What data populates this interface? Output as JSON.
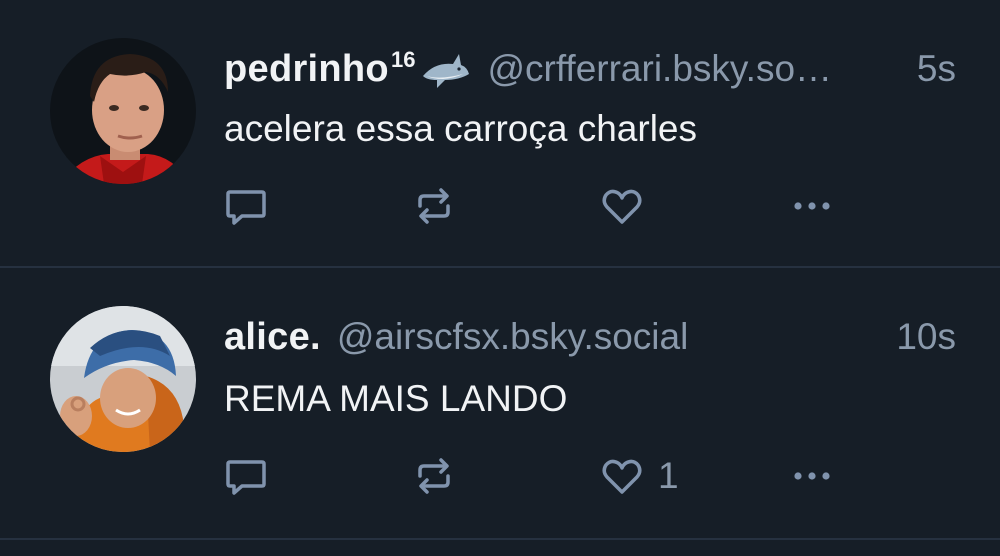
{
  "posts": [
    {
      "display_name": "pedrinho",
      "name_suffix": "16",
      "emoji_icon": "shark-emoji",
      "handle": "@crfferrari.bsky.so…",
      "timestamp": "5s",
      "text": "acelera essa carroça charles",
      "like_count": "",
      "icons": [
        "reply-icon",
        "repost-icon",
        "heart-icon",
        "more-icon"
      ]
    },
    {
      "display_name": "alice.",
      "handle": "@airscfsx.bsky.social",
      "timestamp": "10s",
      "text": "REMA MAIS LANDO",
      "like_count": "1",
      "icons": [
        "reply-icon",
        "repost-icon",
        "heart-icon",
        "more-icon"
      ]
    }
  ],
  "colors": {
    "background": "#161e27",
    "divider": "#263140",
    "primary_text": "#f1f3f5",
    "secondary_text": "#8a99ab",
    "icon": "#8093ad"
  }
}
